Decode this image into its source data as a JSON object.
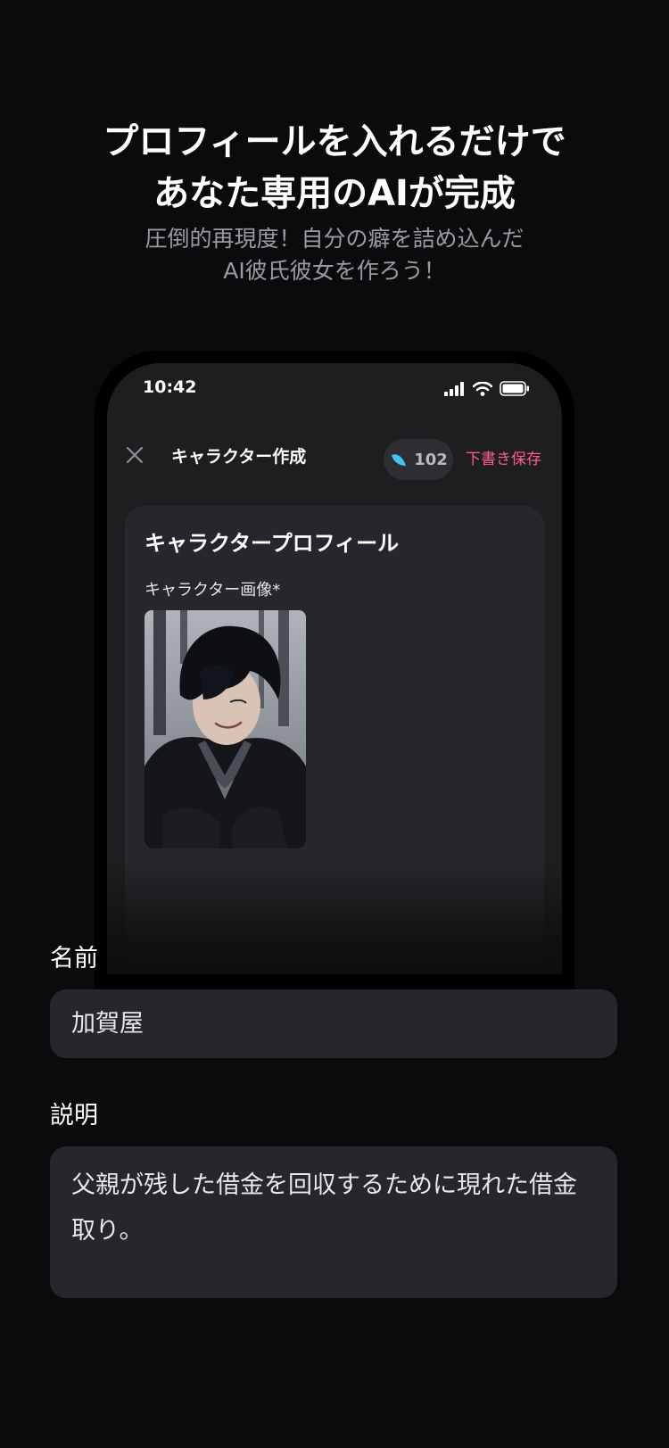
{
  "promo": {
    "headline_line1": "プロフィールを入れるだけで",
    "headline_line2": "あなた専用のAIが完成",
    "sub_line1": "圧倒的再現度！自分の癖を詰め込んだ",
    "sub_line2": "AI彼氏彼女を作ろう！"
  },
  "status_bar": {
    "time": "10:42",
    "icons": [
      "signal-icon",
      "wifi-icon",
      "battery-icon"
    ]
  },
  "nav": {
    "close_icon": "close-icon",
    "title": "キャラクター作成",
    "credit_icon": "feather-icon",
    "credits": "102",
    "draft_save": "下書き保存"
  },
  "profile_card": {
    "title": "キャラクタープロフィール",
    "image_label": "キャラクター画像*"
  },
  "form": {
    "name_label": "名前",
    "name_value": "加賀屋",
    "description_label": "説明",
    "description_value": "父親が残した借金を回収するために現れた借金取り。"
  },
  "colors": {
    "background": "#0b0b0d",
    "screen": "#1e1e21",
    "card": "#27272b",
    "accent_pink": "#ff5c8a",
    "credit_feather": "#3fc4f5",
    "subtext": "#9a9aa0"
  }
}
